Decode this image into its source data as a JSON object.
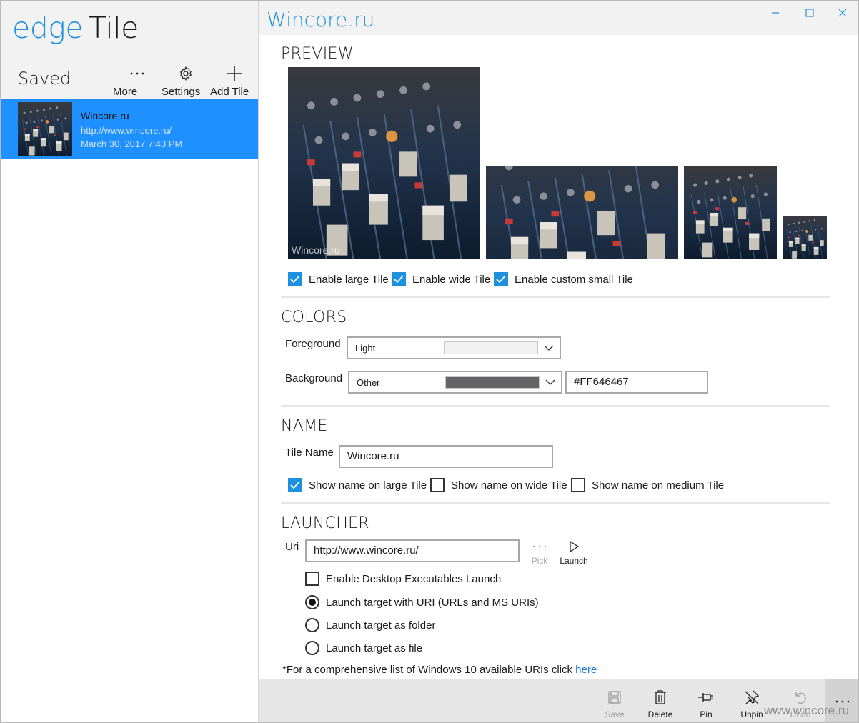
{
  "app": {
    "logo_part1": "edge",
    "logo_part2": "Tile",
    "saved_title": "Saved",
    "tools": [
      {
        "label": "More",
        "icon": "more-icon"
      },
      {
        "label": "Settings",
        "icon": "gear-icon"
      },
      {
        "label": "Add Tile",
        "icon": "plus-icon"
      }
    ],
    "saved_items": [
      {
        "title": "Wincore.ru",
        "url": "http://www.wincore.ru/",
        "date": "March 30, 2017 7:43 PM"
      }
    ]
  },
  "window": {
    "title": "Wincore.ru",
    "controls": [
      "minimize-icon",
      "maximize-icon",
      "close-icon"
    ]
  },
  "preview": {
    "heading": "PREVIEW",
    "tile_watermark": "Wincore.ru",
    "checkboxes": [
      {
        "label": "Enable large Tile",
        "checked": true
      },
      {
        "label": "Enable wide Tile",
        "checked": true
      },
      {
        "label": "Enable custom small Tile",
        "checked": true
      }
    ]
  },
  "colors": {
    "heading": "COLORS",
    "foreground_label": "Foreground",
    "foreground_value": "Light",
    "foreground_swatch": "#f2f2f2",
    "background_label": "Background",
    "background_value": "Other",
    "background_swatch": "#646467",
    "background_hex": "#FF646467"
  },
  "name": {
    "heading": "NAME",
    "tile_name_label": "Tile Name",
    "tile_name_value": "Wincore.ru",
    "checkboxes": [
      {
        "label": "Show name on large Tile",
        "checked": true
      },
      {
        "label": "Show name on wide Tile",
        "checked": false
      },
      {
        "label": "Show name on medium Tile",
        "checked": false
      }
    ]
  },
  "launcher": {
    "heading": "LAUNCHER",
    "uri_label": "Uri",
    "uri_value": "http://www.wincore.ru/",
    "pick_label": "Pick",
    "launch_label": "Launch",
    "desktop_exec": {
      "label": "Enable Desktop Executables Launch",
      "checked": false
    },
    "radios": [
      {
        "label": "Launch target with URI (URLs and MS URIs)",
        "selected": true
      },
      {
        "label": "Launch target as folder",
        "selected": false
      },
      {
        "label": "Launch target as file",
        "selected": false
      }
    ],
    "note_text": "*For a comprehensive list of Windows 10 available URIs click ",
    "note_link": "here"
  },
  "commands": [
    {
      "label": "Save",
      "icon": "save-icon",
      "enabled": false
    },
    {
      "label": "Delete",
      "icon": "trash-icon",
      "enabled": true
    },
    {
      "label": "Pin",
      "icon": "pin-icon",
      "enabled": true
    },
    {
      "label": "Unpin",
      "icon": "unpin-icon",
      "enabled": true
    },
    {
      "label": "Undo",
      "icon": "undo-icon",
      "enabled": false
    }
  ],
  "watermark": "www.wincore.ru",
  "accent": "#1e90ff"
}
